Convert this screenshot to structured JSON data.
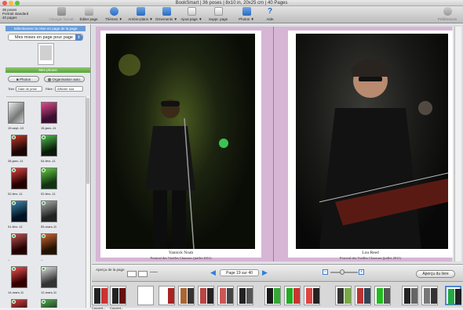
{
  "window": {
    "title": "BookSmart | 36 poses | 8x10 in, 20x25 cm | 40 Pages"
  },
  "project": {
    "line1": "36 poses",
    "line2": "Portrait standard",
    "line3": "40 pages"
  },
  "toolbar": {
    "items": [
      {
        "label": "Changer format"
      },
      {
        "label": "Éditer page"
      },
      {
        "label": "Thèmes ▼"
      },
      {
        "label": "Arrière-plans ▼"
      },
      {
        "label": "Ornements ▼"
      },
      {
        "label": "Ajout page ▼"
      },
      {
        "label": "Suppr. page"
      },
      {
        "label": "Photos ▼"
      },
      {
        "label": "Aide"
      }
    ],
    "preferences": "Préférences"
  },
  "sidebar": {
    "layout_header": "Sélectionnez la mise en page de la page",
    "layout_select": "Mes mises en page pour page",
    "photos_header": "Mes photos",
    "photos_button": "Photos",
    "organize_button": "Organisation auto.",
    "sort_label": "Trier :",
    "sort_value": "Date de prise",
    "filter_label": "Filtre :",
    "filter_value": "Afficher tout",
    "thumbs": [
      {
        "label": "19-sept.-10"
      },
      {
        "label": "15-janv.-11"
      },
      {
        "label": "28-janv.-11"
      },
      {
        "label": "04-févr.-11"
      },
      {
        "label": "02-févr.-11"
      },
      {
        "label": "02-févr.-11"
      },
      {
        "label": "01-févr.-11"
      },
      {
        "label": "05-mars-11"
      },
      {
        "label": "--"
      },
      {
        "label": "--"
      },
      {
        "label": "14-mars-11"
      },
      {
        "label": "12-mars-11"
      },
      {
        "label": "11-mars-11"
      },
      {
        "label": "06-avr.-11"
      }
    ]
  },
  "spread": {
    "left": {
      "name": "Yannick Noah",
      "subtitle": "Festival des Vieilles Charrues (juillet 2011)"
    },
    "right": {
      "name": "Lou Reed",
      "subtitle": "Festival des Vieilles Charrues (juillet 2011)"
    }
  },
  "navbar": {
    "preview_page": "Aperçu de la page",
    "page_indicator": "Page 19 sur 40",
    "preview_book": "Aperçu du livre"
  },
  "filmstrip": {
    "labels": [
      "Couvert...",
      "Couvert..."
    ]
  },
  "colors": {
    "accent": "#4e86d3",
    "spread_bg": "#d6b6d4",
    "photos_header": "#58a33c"
  }
}
